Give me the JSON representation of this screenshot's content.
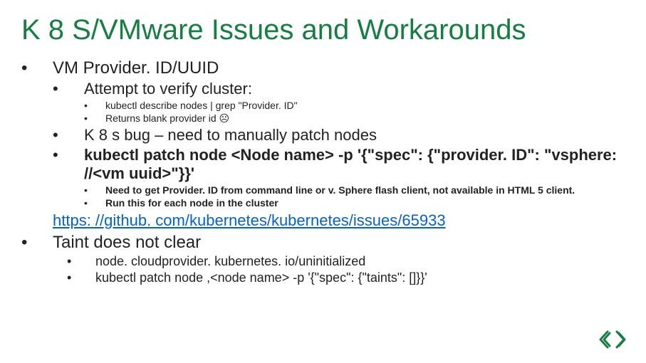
{
  "title": "K 8 S/VMware Issues and Workarounds",
  "section1": {
    "heading": "VM Provider. ID/UUID",
    "sub1": "Attempt to verify cluster:",
    "sub1_items": [
      "kubectl describe nodes | grep \"Provider. ID\"",
      "Returns blank provider id ☹"
    ],
    "sub2": "K 8 s bug – need to manually patch nodes",
    "sub3": "kubectl patch node <Node name> -p '{\"spec\": {\"provider. ID\": \"vsphere: //<vm uuid>\"}}'",
    "sub3_items": [
      "Need to get Provider. ID from command line or v. Sphere flash client, not available in HTML 5 client.",
      "Run this for each node in the cluster"
    ]
  },
  "link": "https: //github. com/kubernetes/kubernetes/issues/65933",
  "section2": {
    "heading": "Taint does not clear",
    "items": [
      "node. cloudprovider. kubernetes. io/uninitialized",
      "kubectl patch node ,<node name> -p '{\"spec\": {\"taints\": []}}'"
    ]
  }
}
